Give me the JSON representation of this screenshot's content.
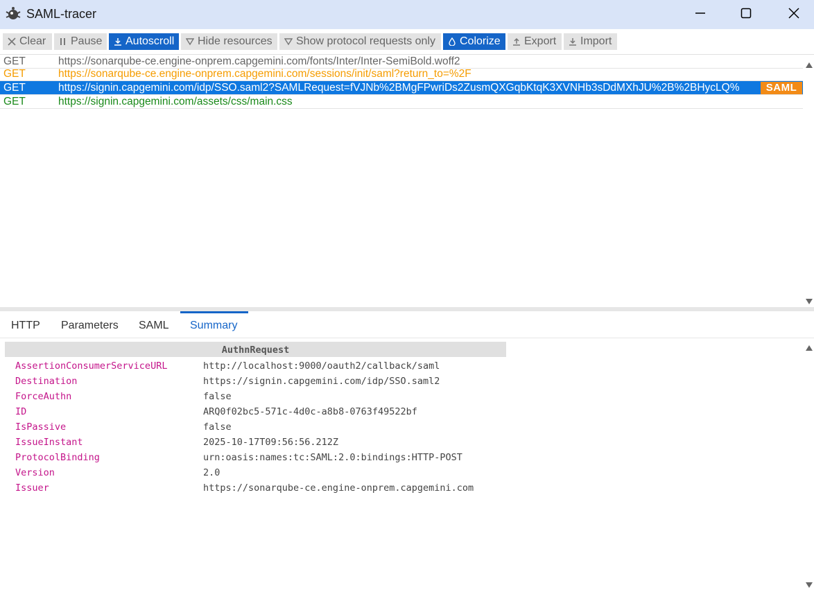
{
  "window": {
    "title": "SAML-tracer"
  },
  "toolbar": {
    "clear": "Clear",
    "pause": "Pause",
    "autoscroll": "Autoscroll",
    "hide_resources": "Hide resources",
    "show_protocol": "Show protocol requests only",
    "colorize": "Colorize",
    "export": "Export",
    "import": "Import"
  },
  "requests": [
    {
      "method": "GET",
      "url": "https://sonarqube-ce.engine-onprem.capgemini.com/fonts/Inter/Inter-SemiBold.woff2"
    },
    {
      "method": "GET",
      "url": "https://sonarqube-ce.engine-onprem.capgemini.com/sessions/init/saml?return_to=%2F"
    },
    {
      "method": "GET",
      "url": "https://signin.capgemini.com/idp/SSO.saml2?SAMLRequest=fVJNb%2BMgFPwriDs2ZusmQXGqbKtqK3XVNHb3sDdMXhJU%2B%2BHycLQ%",
      "badge": "SAML"
    },
    {
      "method": "GET",
      "url": "https://signin.capgemini.com/assets/css/main.css"
    }
  ],
  "tabs": [
    "HTTP",
    "Parameters",
    "SAML",
    "Summary"
  ],
  "summary": {
    "header": "AuthnRequest",
    "rows": [
      {
        "key": "AssertionConsumerServiceURL",
        "value": "http://localhost:9000/oauth2/callback/saml"
      },
      {
        "key": "Destination",
        "value": "https://signin.capgemini.com/idp/SSO.saml2"
      },
      {
        "key": "ForceAuthn",
        "value": "false"
      },
      {
        "key": "ID",
        "value": "ARQ0f02bc5-571c-4d0c-a8b8-0763f49522bf"
      },
      {
        "key": "IsPassive",
        "value": "false"
      },
      {
        "key": "IssueInstant",
        "value": "2025-10-17T09:56:56.212Z"
      },
      {
        "key": "ProtocolBinding",
        "value": "urn:oasis:names:tc:SAML:2.0:bindings:HTTP-POST"
      },
      {
        "key": "Version",
        "value": "2.0"
      },
      {
        "key": "Issuer",
        "value": "https://sonarqube-ce.engine-onprem.capgemini.com"
      }
    ]
  },
  "colors": {
    "accent": "#1565c8",
    "selected_row": "#0f78e0",
    "saml_badge": "#f28b17",
    "key_magenta": "#c4148a",
    "orange_row": "#f59c00",
    "green_row": "#1a8a1a"
  },
  "icons": [
    "tracer-logo-icon",
    "minimize-icon",
    "maximize-icon",
    "close-icon",
    "x-icon",
    "pause-icon",
    "download-icon",
    "filter-icon",
    "drop-icon",
    "upload-icon",
    "scroll-up-icon",
    "scroll-down-icon"
  ]
}
